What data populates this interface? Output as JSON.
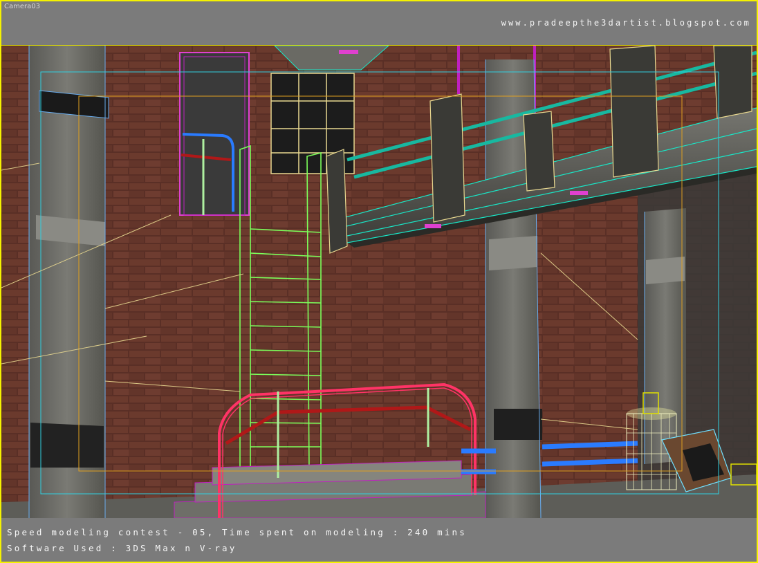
{
  "viewport": {
    "camera_label": "Camera03",
    "watermark": "www.pradeepthe3dartist.blogspot.com"
  },
  "caption": {
    "line1": "Speed modeling contest - 05, Time spent on modeling : 240 mins",
    "line2": "Software Used : 3DS Max n V-ray"
  },
  "colors": {
    "frame": "#f5f200",
    "bars": "#7b7b7b",
    "brick": "#5a2f26",
    "concrete": "#6e6e6a",
    "ladder": "#7bff5a",
    "railing": "#ff3366",
    "pipe": "#2a7bff",
    "teal_rail": "#18b8a0",
    "wire_yellow": "#e8d890",
    "wire_blue": "#6aaef0",
    "magenta": "#c020c0"
  }
}
